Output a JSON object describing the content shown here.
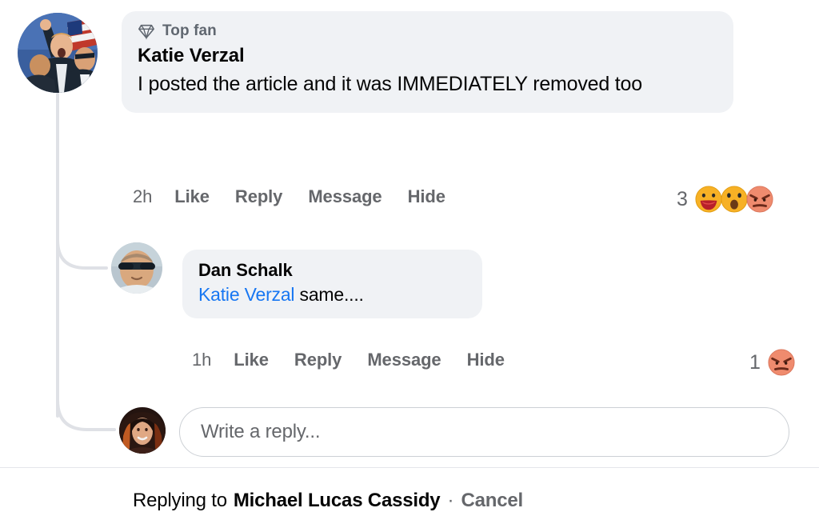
{
  "colors": {
    "bubble_bg": "#F0F2F5",
    "page_bg": "#FFFFFF",
    "primary_text": "#050505",
    "secondary_text": "#65676B",
    "link_blue": "#1877F2",
    "border": "#CCD0D5",
    "divider": "#E4E6EB"
  },
  "comments": [
    {
      "id": "katie-verzal-comment",
      "badge": {
        "icon": "gem-icon",
        "label": "Top fan"
      },
      "avatar_name": "katie-verzal-avatar",
      "author": "Katie Verzal",
      "text": "I posted the article and it was IMMEDIATELY removed too",
      "actions": {
        "timestamp": "2h",
        "like": "Like",
        "reply": "Reply",
        "message": "Message",
        "hide": "Hide"
      },
      "reactions": {
        "count": "3",
        "types": [
          "haha-reaction-icon",
          "wow-reaction-icon",
          "angry-reaction-icon"
        ]
      }
    },
    {
      "id": "dan-schalk-reply",
      "avatar_name": "dan-schalk-avatar",
      "author": "Dan Schalk",
      "mention": "Katie Verzal",
      "text": " same....",
      "actions": {
        "timestamp": "1h",
        "like": "Like",
        "reply": "Reply",
        "message": "Message",
        "hide": "Hide"
      },
      "reactions": {
        "count": "1",
        "types": [
          "angry-reaction-icon"
        ]
      }
    }
  ],
  "reply_composer": {
    "avatar_name": "current-user-avatar",
    "placeholder": "Write a reply..."
  },
  "footer": {
    "replying_to_label": "Replying to",
    "replying_to_name": "Michael Lucas Cassidy",
    "separator": "·",
    "cancel_label": "Cancel"
  }
}
